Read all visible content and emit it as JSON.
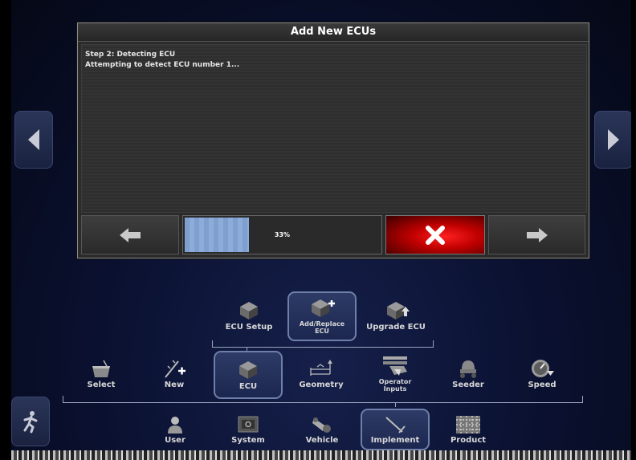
{
  "dialog": {
    "title": "Add New ECUs",
    "messages": [
      "Step 2: Detecting ECU",
      "Attempting to detect ECU number 1..."
    ],
    "progress_text": "33%",
    "progress_value": 0.33
  },
  "menus": {
    "level1": [
      {
        "label": "ECU Setup",
        "icon": "ecu-setup-icon"
      },
      {
        "label": "Add/Replace ECU",
        "icon": "add-replace-ecu-icon",
        "selected": true
      },
      {
        "label": "Upgrade ECU",
        "icon": "upgrade-ecu-icon"
      }
    ],
    "level2": [
      {
        "label": "Select",
        "icon": "basket-icon"
      },
      {
        "label": "New",
        "icon": "new-icon"
      },
      {
        "label": "ECU",
        "icon": "ecu-icon",
        "selected": true
      },
      {
        "label": "Geometry",
        "icon": "geometry-icon"
      },
      {
        "label": "Operator Inputs",
        "icon": "operator-inputs-icon"
      },
      {
        "label": "Seeder",
        "icon": "seeder-icon"
      },
      {
        "label": "Speed",
        "icon": "speed-icon"
      }
    ],
    "level3": [
      {
        "label": "User",
        "icon": "user-icon"
      },
      {
        "label": "System",
        "icon": "system-icon"
      },
      {
        "label": "Vehicle",
        "icon": "vehicle-icon"
      },
      {
        "label": "Implement",
        "icon": "implement-icon",
        "selected": true
      },
      {
        "label": "Product",
        "icon": "product-icon"
      }
    ]
  },
  "colors": {
    "background": "#0b1233",
    "progress": "#7f9fcf",
    "cancel": "#e00000",
    "selected_border": "#6e7faa"
  }
}
